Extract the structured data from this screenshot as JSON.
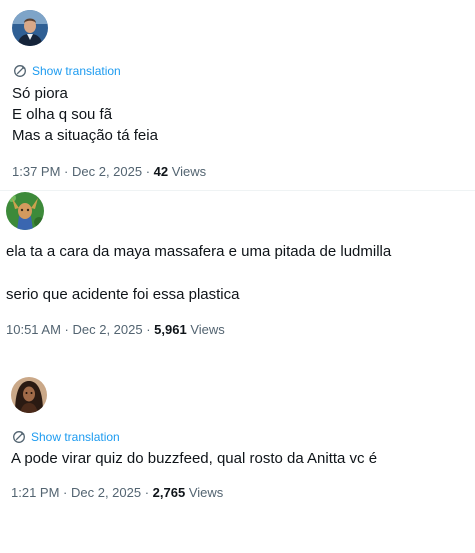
{
  "posts": [
    {
      "show_translation": "Show translation",
      "lines": [
        "Só piora",
        "E olha q sou fã",
        "Mas a situação tá feia"
      ],
      "time": "1:37 PM",
      "sep1": " · ",
      "date": "Dec 2, 2025",
      "sep2": " · ",
      "views_count": "42",
      "views_label": " Views"
    },
    {
      "lines": [
        "ela ta a cara da maya massafera e uma pitada de ludmilla",
        "serio que acidente foi essa plastica"
      ],
      "time": "10:51 AM",
      "sep1": " · ",
      "date": "Dec 2, 2025",
      "sep2": " · ",
      "views_count": "5,961",
      "views_label": " Views"
    },
    {
      "show_translation": "Show translation",
      "lines": [
        "A pode virar quiz do buzzfeed, qual rosto da Anitta vc é"
      ],
      "time": "1:21 PM",
      "sep1": " · ",
      "date": "Dec 2, 2025",
      "sep2": " · ",
      "views_count": "2,765",
      "views_label": " Views"
    }
  ],
  "colors": {
    "link": "#1d9bf0",
    "text": "#0f1419",
    "meta": "#536471",
    "divider": "#eff3f4"
  },
  "icons": {
    "translate": "translate-icon"
  }
}
